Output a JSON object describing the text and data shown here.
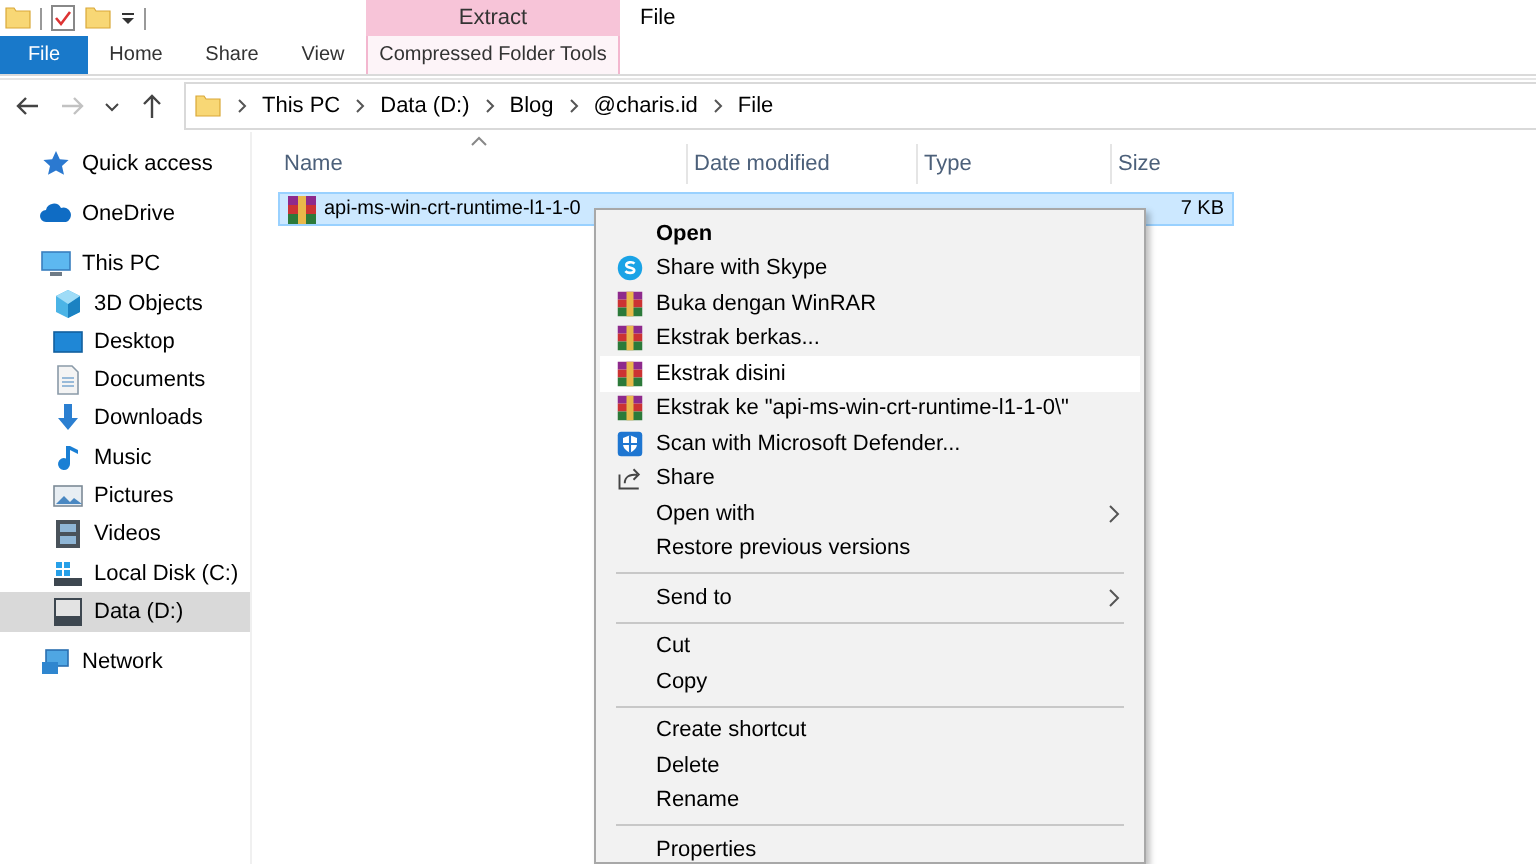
{
  "ribbon": {
    "contextual_group": "Extract",
    "window_title": "File",
    "tabs": [
      {
        "label": "File",
        "kind": "file"
      },
      {
        "label": "Home",
        "kind": "normal"
      },
      {
        "label": "Share",
        "kind": "normal"
      },
      {
        "label": "View",
        "kind": "normal"
      },
      {
        "label": "Compressed Folder Tools",
        "kind": "contextual"
      }
    ]
  },
  "nav_buttons": [
    {
      "kind": "back",
      "disabled": false
    },
    {
      "kind": "forward",
      "disabled": true
    },
    {
      "kind": "recent",
      "disabled": false
    },
    {
      "kind": "up",
      "disabled": false
    }
  ],
  "address_bar": {
    "path": [
      "This PC",
      "Data (D:)",
      "Blog",
      "@charis.id",
      "File"
    ]
  },
  "sidebar": {
    "items": [
      {
        "label": "Quick access",
        "kind": "star",
        "selected": false
      },
      {
        "label": "OneDrive",
        "kind": "cloud",
        "selected": false
      },
      {
        "label": "This PC",
        "kind": "pc",
        "selected": false,
        "children": [
          {
            "label": "3D Objects",
            "kind": "cube",
            "selected": false
          },
          {
            "label": "Desktop",
            "kind": "desktop",
            "selected": false
          },
          {
            "label": "Documents",
            "kind": "document",
            "selected": false
          },
          {
            "label": "Downloads",
            "kind": "download",
            "selected": false
          },
          {
            "label": "Music",
            "kind": "music",
            "selected": false
          },
          {
            "label": "Pictures",
            "kind": "pictures",
            "selected": false
          },
          {
            "label": "Videos",
            "kind": "video",
            "selected": false
          },
          {
            "label": "Local Disk (C:)",
            "kind": "systemdrive",
            "selected": false
          },
          {
            "label": "Data (D:)",
            "kind": "drive",
            "selected": true
          }
        ]
      },
      {
        "label": "Network",
        "kind": "network",
        "selected": false
      }
    ]
  },
  "file_list": {
    "columns": [
      {
        "label": "Name",
        "sorted": true
      },
      {
        "label": "Date modified",
        "sorted": false
      },
      {
        "label": "Type",
        "sorted": false
      },
      {
        "label": "Size",
        "sorted": false
      }
    ],
    "rows": [
      {
        "name": "api-ms-win-crt-runtime-l1-1-0",
        "size": "7 KB",
        "selected": true
      }
    ]
  },
  "context_menu": {
    "items": [
      {
        "kind": "plain",
        "label": "Open",
        "default": true,
        "selected": false,
        "submenu": false
      },
      {
        "kind": "skype",
        "label": "Share with Skype",
        "default": false,
        "selected": false,
        "submenu": false
      },
      {
        "kind": "winrar",
        "label": "Buka dengan WinRAR",
        "default": false,
        "selected": false,
        "submenu": false
      },
      {
        "kind": "winrar",
        "label": "Ekstrak berkas...",
        "default": false,
        "selected": false,
        "submenu": false
      },
      {
        "kind": "winrar",
        "label": "Ekstrak disini",
        "default": false,
        "selected": true,
        "submenu": false
      },
      {
        "kind": "winrar",
        "label": "Ekstrak ke \"api-ms-win-crt-runtime-l1-1-0\\\"",
        "default": false,
        "selected": false,
        "submenu": false
      },
      {
        "kind": "defender",
        "label": "Scan with Microsoft Defender...",
        "default": false,
        "selected": false,
        "submenu": false
      },
      {
        "kind": "share",
        "label": "Share",
        "default": false,
        "selected": false,
        "submenu": false
      },
      {
        "kind": "plain",
        "label": "Open with",
        "default": false,
        "selected": false,
        "submenu": true
      },
      {
        "kind": "plain",
        "label": "Restore previous versions",
        "default": false,
        "selected": false,
        "submenu": false
      },
      {
        "kind": "separator"
      },
      {
        "kind": "plain",
        "label": "Send to",
        "default": false,
        "selected": false,
        "submenu": true
      },
      {
        "kind": "separator"
      },
      {
        "kind": "plain",
        "label": "Cut",
        "default": false,
        "selected": false,
        "submenu": false
      },
      {
        "kind": "plain",
        "label": "Copy",
        "default": false,
        "selected": false,
        "submenu": false
      },
      {
        "kind": "separator"
      },
      {
        "kind": "plain",
        "label": "Create shortcut",
        "default": false,
        "selected": false,
        "submenu": false
      },
      {
        "kind": "plain",
        "label": "Delete",
        "default": false,
        "selected": false,
        "submenu": false
      },
      {
        "kind": "plain",
        "label": "Rename",
        "default": false,
        "selected": false,
        "submenu": false
      },
      {
        "kind": "separator"
      },
      {
        "kind": "plain",
        "label": "Properties",
        "default": false,
        "selected": false,
        "submenu": false
      }
    ]
  }
}
